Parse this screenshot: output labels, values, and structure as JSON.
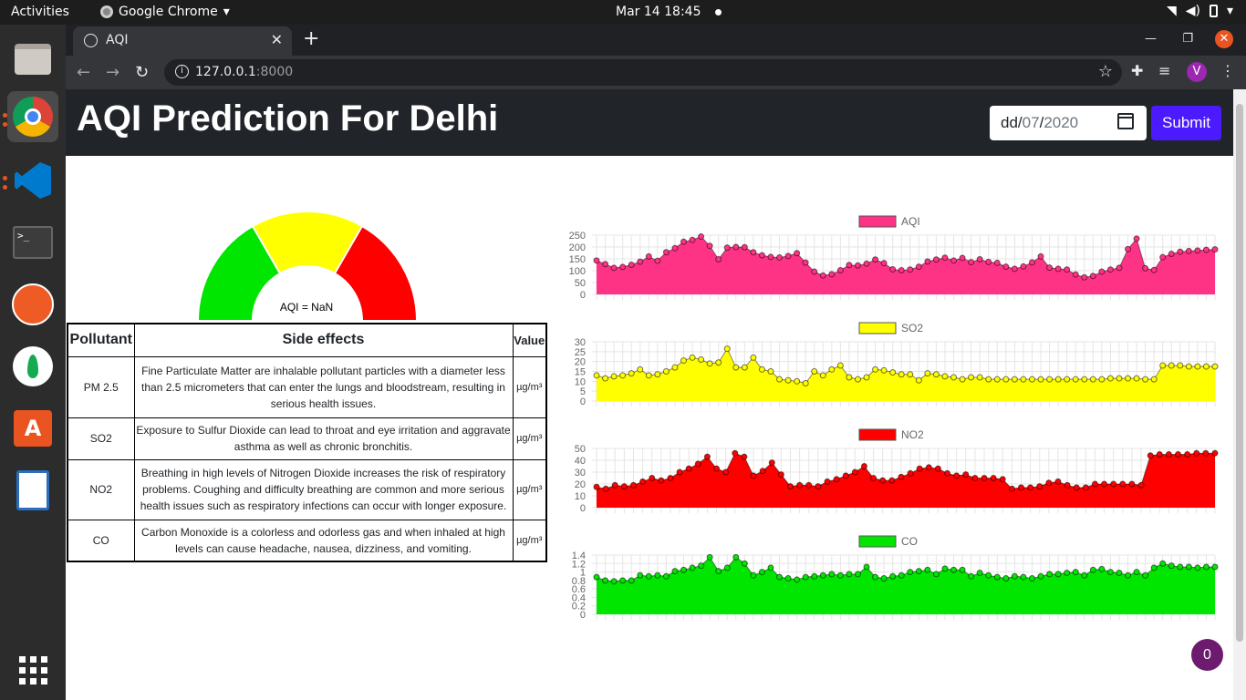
{
  "system": {
    "activities": "Activities",
    "app_name": "Google Chrome",
    "clock": "Mar 14  18:45"
  },
  "browser": {
    "tab_title": "AQI",
    "url_host": "127.0.0.1",
    "url_port": ":8000",
    "avatar_letter": "V"
  },
  "header": {
    "title": "AQI Prediction For Delhi",
    "date_day": "dd",
    "date_sep": "/",
    "date_month": "07",
    "date_year": "2020",
    "submit_label": "Submit"
  },
  "gauge": {
    "label": "AQI = NaN",
    "colors": [
      "#00e600",
      "#ffff00",
      "#ff0000"
    ]
  },
  "table": {
    "headers": {
      "pollutant": "Pollutant",
      "effects": "Side effects",
      "value": "Value"
    },
    "rows": [
      {
        "name": "PM 2.5",
        "effect": "Fine Particulate Matter are inhalable pollutant particles with a diameter less than 2.5 micrometers that can enter the lungs and bloodstream, resulting in serious health issues.",
        "value": "µg/m³"
      },
      {
        "name": "SO2",
        "effect": "Exposure to Sulfur Dioxide can lead to throat and eye irritation and aggravate asthma as well as chronic bronchitis.",
        "value": "µg/m³"
      },
      {
        "name": "NO2",
        "effect": "Breathing in high levels of Nitrogen Dioxide increases the risk of respiratory problems. Coughing and difficulty breathing are common and more serious health issues such as respiratory infections can occur with longer exposure.",
        "value": "µg/m³"
      },
      {
        "name": "CO",
        "effect": "Carbon Monoxide is a colorless and odorless gas and when inhaled at high levels can cause headache, nausea, dizziness, and vomiting.",
        "value": "µg/m³"
      }
    ]
  },
  "fab_count": "0",
  "chart_data": [
    {
      "type": "area",
      "series": [
        {
          "name": "AQI",
          "color": "#ff3385",
          "values": [
            143,
            128,
            112,
            116,
            125,
            138,
            160,
            142,
            178,
            195,
            222,
            230,
            244,
            205,
            148,
            197,
            200,
            199,
            178,
            165,
            158,
            156,
            162,
            174,
            134,
            96,
            80,
            85,
            102,
            124,
            122,
            130,
            147,
            132,
            106,
            102,
            105,
            117,
            139,
            147,
            155,
            143,
            154,
            136,
            148,
            137,
            133,
            117,
            108,
            118,
            135,
            160,
            113,
            108,
            105,
            84,
            72,
            78,
            96,
            105,
            112,
            191,
            235,
            110,
            103,
            157,
            171,
            180,
            183,
            185,
            188,
            190
          ]
        }
      ],
      "ylim": [
        0,
        250
      ],
      "yticks": [
        0,
        50,
        100,
        150,
        200,
        250
      ]
    },
    {
      "type": "area",
      "series": [
        {
          "name": "SO2",
          "color": "#ffff00",
          "values": [
            13,
            11.5,
            12.5,
            13,
            14,
            16,
            13,
            13.5,
            15,
            17,
            20.5,
            22,
            21,
            19,
            19.5,
            26.5,
            17,
            17,
            22,
            16,
            15,
            11,
            10.5,
            10,
            9,
            15,
            13,
            16,
            18,
            12,
            11,
            12,
            16,
            15.5,
            14.5,
            13.5,
            13.5,
            10.5,
            14,
            13.5,
            12.5,
            12,
            11,
            12,
            12,
            11,
            11,
            11,
            11,
            11,
            11,
            11,
            11,
            11,
            11,
            11,
            11,
            11,
            11,
            11.5,
            11.5,
            11.5,
            11.5,
            11,
            11,
            18,
            18,
            18,
            17.5,
            17.5,
            17.5,
            17.5
          ]
        }
      ],
      "ylim": [
        0,
        30
      ],
      "yticks": [
        0,
        5,
        10,
        15,
        20,
        25,
        30
      ]
    },
    {
      "type": "area",
      "series": [
        {
          "name": "NO2",
          "color": "#ff0000",
          "values": [
            17.5,
            16,
            19,
            18,
            19,
            22,
            25,
            23,
            25,
            30,
            33,
            37,
            43,
            33,
            30,
            46,
            43,
            27,
            31,
            38,
            28,
            18,
            19,
            19,
            18,
            22,
            24,
            27,
            30,
            35,
            25,
            23,
            23,
            26,
            29,
            33,
            34,
            33,
            29,
            27,
            28,
            25,
            25,
            25,
            24,
            16,
            17,
            17,
            18,
            21,
            22,
            19,
            17,
            17,
            20,
            20,
            20,
            20,
            20,
            19,
            44,
            45,
            45,
            45,
            45,
            46,
            46,
            46
          ]
        }
      ],
      "ylim": [
        0,
        50
      ],
      "yticks": [
        0,
        10,
        20,
        30,
        40,
        50
      ]
    },
    {
      "type": "area",
      "series": [
        {
          "name": "CO",
          "color": "#00e600",
          "values": [
            0.88,
            0.8,
            0.78,
            0.8,
            0.8,
            0.92,
            0.9,
            0.92,
            0.9,
            1.02,
            1.05,
            1.1,
            1.15,
            1.35,
            1.02,
            1.1,
            1.35,
            1.2,
            0.92,
            1.0,
            1.1,
            0.88,
            0.85,
            0.82,
            0.88,
            0.9,
            0.92,
            0.95,
            0.92,
            0.95,
            0.95,
            1.12,
            0.88,
            0.85,
            0.9,
            0.92,
            1.0,
            1.02,
            1.05,
            0.95,
            1.08,
            1.05,
            1.05,
            0.9,
            0.98,
            0.92,
            0.88,
            0.85,
            0.9,
            0.88,
            0.85,
            0.9,
            0.95,
            0.95,
            0.98,
            1.0,
            0.92,
            1.05,
            1.07,
            1.0,
            0.98,
            0.92,
            1.0,
            0.92,
            1.1,
            1.2,
            1.15,
            1.12,
            1.12,
            1.1,
            1.12,
            1.12
          ]
        }
      ],
      "ylim": [
        0,
        1.4
      ],
      "yticks": [
        0,
        0.2,
        0.4,
        0.6,
        0.8,
        1.0,
        1.2,
        1.4
      ]
    }
  ]
}
